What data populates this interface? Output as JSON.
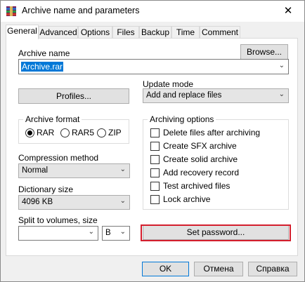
{
  "title": "Archive name and parameters",
  "tabs": [
    "General",
    "Advanced",
    "Options",
    "Files",
    "Backup",
    "Time",
    "Comment"
  ],
  "archive_name": {
    "label": "Archive name",
    "value": "Archive.rar",
    "browse_label": "Browse..."
  },
  "profiles_label": "Profiles...",
  "update_mode": {
    "label": "Update mode",
    "value": "Add and replace files"
  },
  "archive_format": {
    "label": "Archive format",
    "options": [
      {
        "label": "RAR",
        "selected": true
      },
      {
        "label": "RAR5",
        "selected": false
      },
      {
        "label": "ZIP",
        "selected": false
      }
    ]
  },
  "archiving_options": {
    "label": "Archiving options",
    "items": [
      "Delete files after archiving",
      "Create SFX archive",
      "Create solid archive",
      "Add recovery record",
      "Test archived files",
      "Lock archive"
    ]
  },
  "compression": {
    "label": "Compression method",
    "value": "Normal"
  },
  "dictionary": {
    "label": "Dictionary size",
    "value": "4096 KB"
  },
  "split": {
    "label": "Split to volumes, size",
    "value": "",
    "unit": "B"
  },
  "set_password_label": "Set password...",
  "footer": {
    "ok": "OK",
    "cancel": "Отмена",
    "help": "Справка"
  },
  "colors": {
    "highlight_border": "#d41e2d",
    "selection": "#0078d7"
  }
}
